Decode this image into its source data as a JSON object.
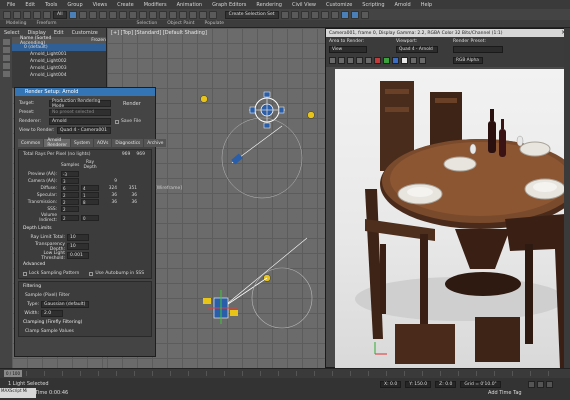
{
  "menubar": {
    "items": [
      "File",
      "Edit",
      "Tools",
      "Group",
      "Views",
      "Create",
      "Modifiers",
      "Animation",
      "Graph Editors",
      "Rendering",
      "Civil View",
      "Customize",
      "Scripting",
      "Arnold",
      "Help"
    ],
    "workspace": "Workspace"
  },
  "toolbar": {
    "select_filter": "All",
    "selection_set": "Create Selection Set"
  },
  "ribbon": {
    "tabs": [
      "Modeling",
      "Freeform",
      "Selection",
      "Object Paint",
      "Populate"
    ]
  },
  "explorer": {
    "tabs": [
      "Select",
      "Display",
      "Edit",
      "Customize"
    ],
    "header": "Name (Sorted Ascending)",
    "header2": "Frozen",
    "rows": [
      "0 (default)",
      "Arnold_Light001",
      "Arnold_Light002",
      "Arnold_Light003",
      "Arnold_Light004"
    ]
  },
  "viewport": {
    "label": "[+] [Top] [Standard] [Default Shading]",
    "camera_label": "[Wireframe]"
  },
  "render_setup": {
    "title": "Render Setup: Arnold",
    "target_label": "Target:",
    "target_value": "Production Rendering Mode",
    "preset_label": "Preset:",
    "preset_value": "No preset selected",
    "renderer_label": "Renderer:",
    "renderer_value": "Arnold",
    "save_file": "Save File",
    "render_button": "Render",
    "view_label": "View to Render:",
    "view_value": "Quad 4 - Camera001",
    "tabs": [
      "Common",
      "Arnold Renderer",
      "System",
      "AOVs",
      "Diagnostics",
      "Archive"
    ],
    "total_rays_label": "Total Rays Per Pixel (no lights)",
    "total_rays_values": [
      "969",
      "969"
    ],
    "sampling_cols": [
      "Samples",
      "Ray Depth"
    ],
    "preview_label": "Preview (AA):",
    "preview_value": "-3",
    "rows": [
      {
        "label": "Camera (AA):",
        "s": "3",
        "d": "",
        "a": "9",
        "b": ""
      },
      {
        "label": "Diffuse:",
        "s": "6",
        "d": "4",
        "a": "324",
        "b": "351"
      },
      {
        "label": "Specular:",
        "s": "2",
        "d": "1",
        "a": "36",
        "b": "36"
      },
      {
        "label": "Transmission:",
        "s": "2",
        "d": "8",
        "a": "36",
        "b": "36"
      },
      {
        "label": "SSS:",
        "s": "2",
        "d": "",
        "a": "",
        "b": ""
      },
      {
        "label": "Volume Indirect:",
        "s": "2",
        "d": "0",
        "a": "",
        "b": ""
      }
    ],
    "depth_limits": "Depth Limits",
    "ray_limit_label": "Ray Limit Total:",
    "ray_limit_value": "10",
    "transparency_label": "Transparency Depth:",
    "transparency_value": "10",
    "low_light_label": "Low Light Threshold:",
    "low_light_value": "0.001",
    "advanced": "Advanced",
    "lock_sampling": "Lock Sampling Pattern",
    "autobump": "Use Autobump in SSS",
    "filtering": "Filtering",
    "filter_label": "Sample (Pixel) Filter",
    "type_label": "Type:",
    "type_value": "Gaussian (default)",
    "width_label": "Width:",
    "width_value": "2.0",
    "clamping": "Clamping (Firefly Filtering)",
    "clamp_values": "Clamp Sample Values"
  },
  "frame_window": {
    "title": "Camera001, frame 0, Display Gamma: 2.2, RGBA Color 32 Bits/Channel (1:1)",
    "area_label": "Area to Render:",
    "area_value": "View",
    "viewport_label": "Viewport:",
    "viewport_value": "Quad 4 - Arnold",
    "preset_label": "Render Preset:",
    "preset_value": "",
    "channel_value": "RGB Alpha"
  },
  "timeline": {
    "slider": "0 / 100"
  },
  "status": {
    "selected": "1 Light Selected",
    "render_time": "Rendering Time 0:00:46",
    "maxscript": "MAXScript Mi",
    "x": "X: 0.0",
    "y": "Y: 150.0",
    "z": "Z: 0.0",
    "grid": "Grid = 0'10.0\"",
    "add_tag": "Add Time Tag"
  },
  "colors": {
    "accent": "#3375b5",
    "viewport_bg": "#6b6b6b",
    "render_bg": "#ececec"
  }
}
